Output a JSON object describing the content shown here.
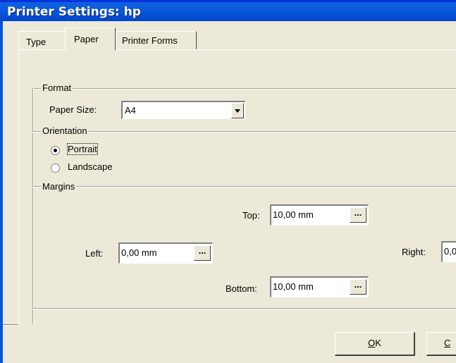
{
  "window": {
    "title": "Printer Settings: hp"
  },
  "tabs": [
    {
      "label": "Type",
      "active": false
    },
    {
      "label": "Paper",
      "active": true
    },
    {
      "label": "Printer Forms",
      "active": false
    }
  ],
  "format": {
    "group_label": "Format",
    "paper_size_label": "Paper Size:",
    "paper_size_value": "A4"
  },
  "orientation": {
    "group_label": "Orientation",
    "options": [
      {
        "label": "Portrait",
        "selected": true
      },
      {
        "label": "Landscape",
        "selected": false
      }
    ]
  },
  "margins": {
    "group_label": "Margins",
    "top": {
      "label": "Top:",
      "value": "10,00 mm"
    },
    "left": {
      "label": "Left:",
      "value": "0,00 mm"
    },
    "right": {
      "label": "Right:",
      "value": "0,0"
    },
    "bottom": {
      "label": "Bottom:",
      "value": "10,00 mm"
    },
    "browse_label": "..."
  },
  "buttons": {
    "ok": {
      "mnemonic": "O",
      "rest": "K"
    },
    "cancel": {
      "mnemonic": "C",
      "rest": ""
    }
  },
  "colors": {
    "titlebar": "#0553da",
    "dialog_bg": "#ece9d8"
  }
}
